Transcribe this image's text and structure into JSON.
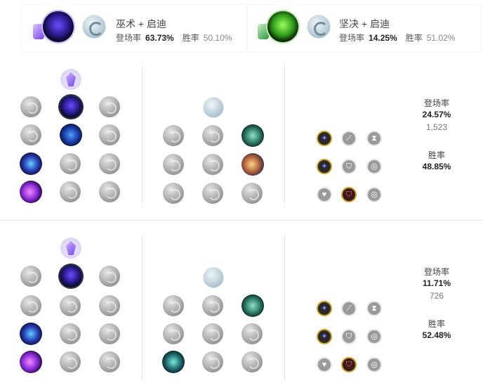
{
  "summary": [
    {
      "title": "巫术 + 启迪",
      "pick_label": "登场率",
      "pick_rate": "63.73%",
      "win_label": "胜率",
      "win_rate": "50.10%",
      "key_icon": "phase-rush-icon",
      "tree_icon": "sorcery-tree-icon",
      "secondary_icon": "inspiration-tree-icon"
    },
    {
      "title": "坚决 + 启迪",
      "pick_label": "登场率",
      "pick_rate": "14.25%",
      "win_label": "胜率",
      "win_rate": "51.02%",
      "key_icon": "grasp-icon",
      "tree_icon": "resolve-tree-icon",
      "secondary_icon": "inspiration-tree-icon"
    }
  ],
  "pages": [
    {
      "stats": {
        "pick_label": "登场率",
        "pick_rate": "24.57%",
        "games": "1,523",
        "win_label": "胜率",
        "win_rate": "48.85%"
      }
    },
    {
      "stats": {
        "pick_label": "登场率",
        "pick_rate": "11.71%",
        "games": "726",
        "win_label": "胜率",
        "win_rate": "52.48%"
      }
    }
  ],
  "colors": {
    "sorcery": "#8a5cff",
    "resolve": "#2fb14c",
    "inspiration": "#4db3c8",
    "shard_gold": "#c9a227"
  }
}
